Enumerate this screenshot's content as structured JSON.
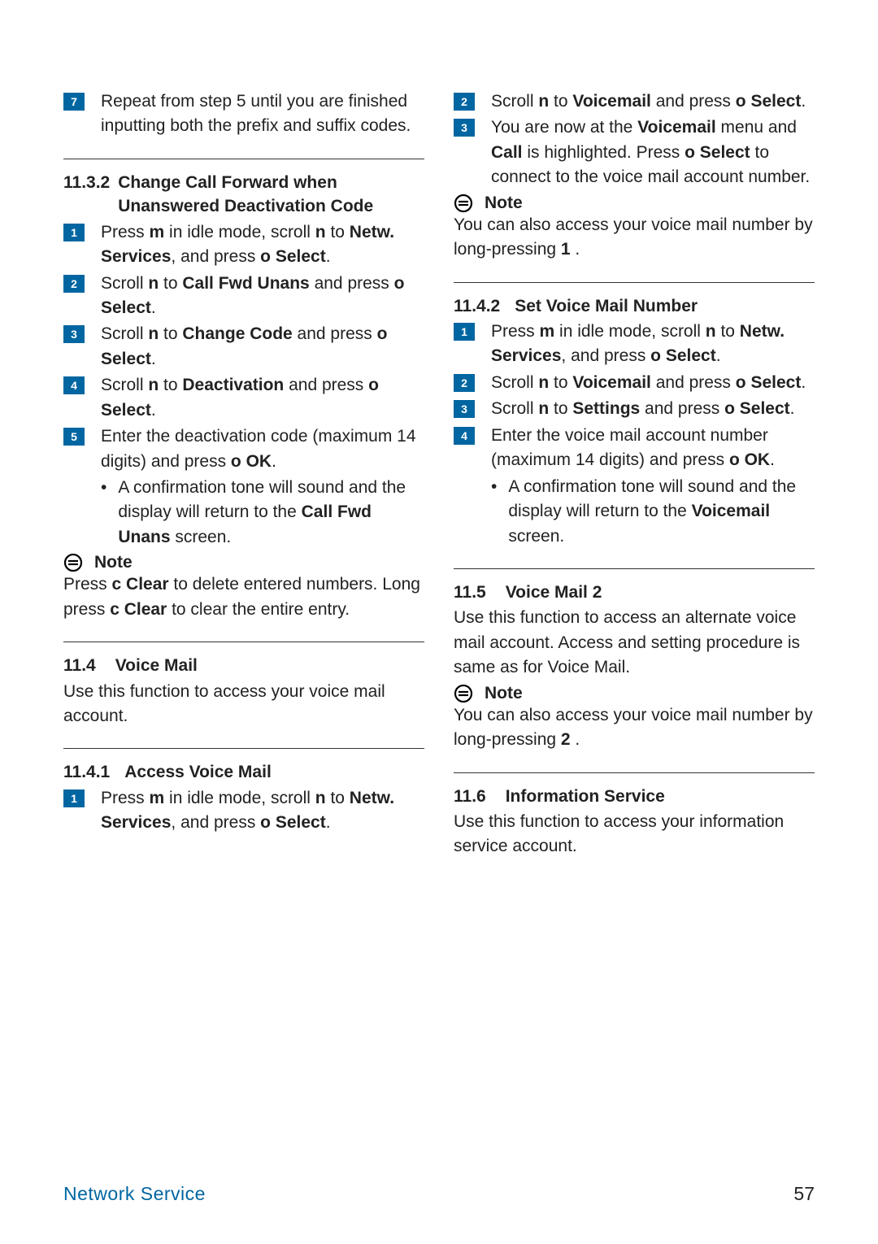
{
  "footer": {
    "section": "Network Service",
    "page": "57"
  },
  "left": {
    "step7": {
      "num": "7",
      "text": "Repeat from step 5 until you are finished inputting both the prefix and suffix codes."
    },
    "sec1132": {
      "num": "11.3.2",
      "title": "Change Call Forward when Unanswered Deactivation Code",
      "s1": {
        "num": "1",
        "t1": "Press ",
        "b1": "m",
        "t2": "  in idle mode, scroll ",
        "b2": "n",
        "t3": "  to ",
        "b3": "Netw. Services",
        "t4": ", and press ",
        "b4": "o  Select",
        "t5": "."
      },
      "s2": {
        "num": "2",
        "t1": "Scroll ",
        "b1": "n",
        "t2": "  to ",
        "b2": "Call Fwd Unans",
        "t3": " and press ",
        "b3": "o    Select",
        "t4": "."
      },
      "s3": {
        "num": "3",
        "t1": "Scroll ",
        "b1": "n",
        "t2": "  to ",
        "b2": "Change Code",
        "t3": " and press ",
        "b3": "o    Select",
        "t4": "."
      },
      "s4": {
        "num": "4",
        "t1": "Scroll ",
        "b1": "n",
        "t2": "  to ",
        "b2": "Deactivation",
        "t3": " and press ",
        "b3": "o    Select",
        "t4": "."
      },
      "s5": {
        "num": "5",
        "t1": "Enter the deactivation code (maximum 14 digits) and press ",
        "b1": "o  OK",
        "t2": "."
      },
      "bullet": {
        "t1": "A confirmation tone will sound and the display will return to the ",
        "b1": "Call Fwd Unans",
        "t2": " screen."
      },
      "note_label": "Note",
      "note_text": {
        "t1": "Press ",
        "b1": "c    Clear",
        "t2": " to delete entered numbers. Long press ",
        "b2": "c    Clear",
        "t3": " to clear the entire entry."
      }
    },
    "sec114": {
      "num": "11.4",
      "title": "Voice Mail",
      "para": "Use this function to access your voice mail account."
    },
    "sec1141": {
      "num": "11.4.1",
      "title": "Access Voice Mail",
      "s1": {
        "num": "1",
        "t1": "Press ",
        "b1": "m",
        "t2": "  in idle mode, scroll ",
        "b2": "n",
        "t3": "  to ",
        "b3": "Netw. Services",
        "t4": ", and press ",
        "b4": "o  Select",
        "t5": "."
      }
    }
  },
  "right": {
    "s2": {
      "num": "2",
      "t1": "Scroll ",
      "b1": "n",
      "t2": "  to ",
      "b2": "Voicemail",
      "t3": " and press ",
      "b3": "o    Select",
      "t4": "."
    },
    "s3": {
      "num": "3",
      "t1": "You are now at the ",
      "b1": "Voicemail",
      "t2": " menu and ",
      "b2": "Call",
      "t3": " is highlighted. Press ",
      "b3": "o    Select",
      "t4": " to connect to the voice mail account number."
    },
    "note1_label": "Note",
    "note1_text": {
      "t1": "You can also access your voice mail number by long-pressing ",
      "b1": "1",
      "t2": "  ."
    },
    "sec1142": {
      "num": "11.4.2",
      "title": "Set Voice Mail Number",
      "s1": {
        "num": "1",
        "t1": "Press ",
        "b1": "m",
        "t2": "  in idle mode, scroll ",
        "b2": "n",
        "t3": "  to ",
        "b3": "Netw. Services",
        "t4": ", and press ",
        "b4": "o  Select",
        "t5": "."
      },
      "s2": {
        "num": "2",
        "t1": "Scroll ",
        "b1": "n",
        "t2": "  to ",
        "b2": "Voicemail",
        "t3": " and press ",
        "b3": "o    Select",
        "t4": "."
      },
      "s3": {
        "num": "3",
        "t1": "Scroll ",
        "b1": "n",
        "t2": "  to ",
        "b2": "Settings",
        "t3": " and press ",
        "b3": "o    Select",
        "t4": "."
      },
      "s4": {
        "num": "4",
        "t1": "Enter the voice mail account number (maximum 14 digits) and press ",
        "b1": "o    OK",
        "t2": "."
      },
      "bullet": {
        "t1": "A confirmation tone will sound and the display will return to the ",
        "b1": "Voicemail",
        "t2": " screen."
      }
    },
    "sec115": {
      "num": "11.5",
      "title": "Voice Mail 2",
      "para": "Use this function to access an alternate voice mail account. Access and setting procedure is same as for Voice Mail.",
      "note_label": "Note",
      "note_text": {
        "t1": "You can also access your voice mail number by long-pressing ",
        "b1": "2",
        "t2": "  ."
      }
    },
    "sec116": {
      "num": "11.6",
      "title": "Information Service",
      "para": "Use this function to access your information service account."
    }
  }
}
